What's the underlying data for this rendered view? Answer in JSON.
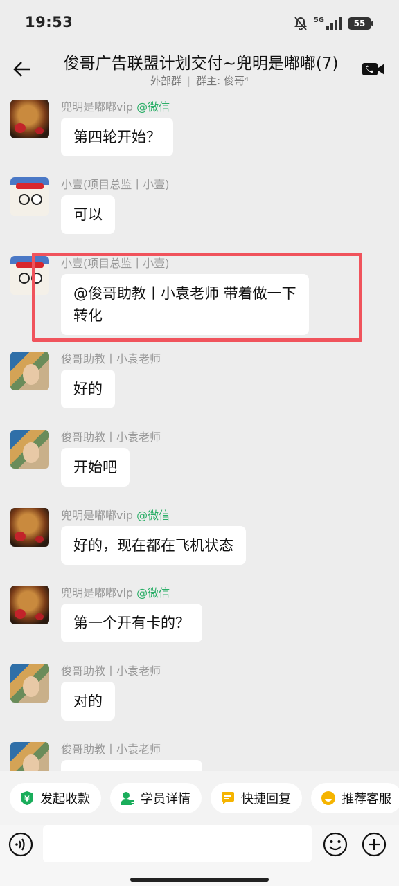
{
  "status_bar": {
    "time": "19:53",
    "battery": "55",
    "network": "5G"
  },
  "header": {
    "title": "俊哥广告联盟计划交付~兜明是嘟嘟(7)",
    "group_type": "外部群",
    "group_owner": "群主: 俊哥⁴"
  },
  "messages": [
    {
      "sender": "兜明是嘟嘟vip",
      "wechat_tag": "@微信",
      "avatar": "tiger-avatar",
      "text": "第四轮开始？"
    },
    {
      "sender": "小壹(项目总监丨小壹)",
      "wechat_tag": "",
      "avatar": "dog-avatar",
      "text": "可以"
    },
    {
      "sender": "小壹(项目总监丨小壹)",
      "wechat_tag": "",
      "avatar": "dog-avatar",
      "text": "@俊哥助教丨小袁老师 带着做一下\n转化"
    },
    {
      "sender": "俊哥助教丨小袁老师",
      "wechat_tag": "",
      "avatar": "girl-avatar",
      "text": "好的"
    },
    {
      "sender": "俊哥助教丨小袁老师",
      "wechat_tag": "",
      "avatar": "girl-avatar",
      "text": "开始吧"
    },
    {
      "sender": "兜明是嘟嘟vip",
      "wechat_tag": "@微信",
      "avatar": "tiger-avatar",
      "text": "好的，现在都在飞机状态"
    },
    {
      "sender": "兜明是嘟嘟vip",
      "wechat_tag": "@微信",
      "avatar": "tiger-avatar",
      "text": "第一个开有卡的？"
    },
    {
      "sender": "俊哥助教丨小袁老师",
      "wechat_tag": "",
      "avatar": "girl-avatar",
      "text": "对的"
    },
    {
      "sender": "俊哥助教丨小袁老师",
      "wechat_tag": "",
      "avatar": "girl-avatar",
      "text": ""
    }
  ],
  "quick_actions": [
    {
      "label": "发起收款",
      "icon": "yuan-shield-icon",
      "color": "#1aad5b"
    },
    {
      "label": "学员详情",
      "icon": "user-detail-icon",
      "color": "#1aad5b"
    },
    {
      "label": "快捷回复",
      "icon": "quick-reply-icon",
      "color": "#f5b400"
    },
    {
      "label": "推荐客服",
      "icon": "recommend-service-icon",
      "color": "#f5b400"
    }
  ],
  "input": {
    "placeholder": ""
  },
  "colors": {
    "highlight": "#f0535c",
    "wechat_green": "#2aae67"
  }
}
